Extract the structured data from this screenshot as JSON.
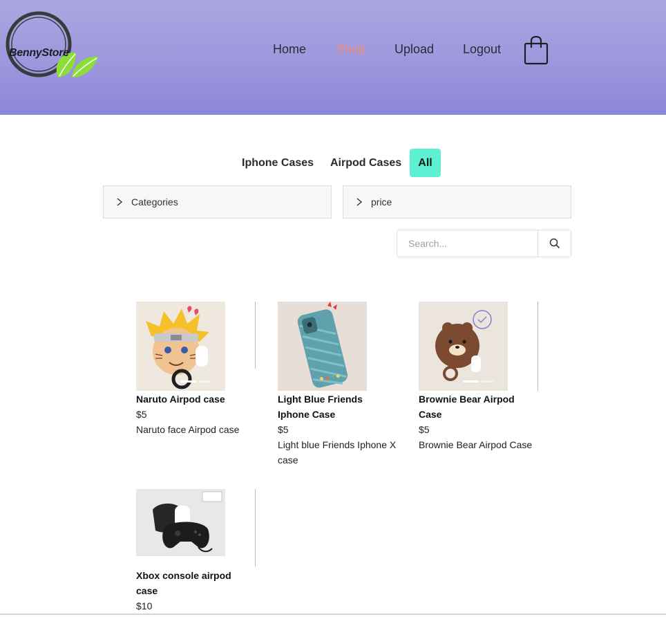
{
  "brand": {
    "name": "BennyStore",
    "leaf_color": "#8cdc3a",
    "ring_color": "#3a3a3a"
  },
  "nav": {
    "items": [
      {
        "label": "Home",
        "active": false
      },
      {
        "label": "Shop",
        "active": true
      },
      {
        "label": "Upload",
        "active": false
      },
      {
        "label": "Logout",
        "active": false
      }
    ],
    "active_color": "#f08a78",
    "cart_icon": "shopping-bag-icon"
  },
  "filters": {
    "tabs": [
      {
        "label": "Iphone Cases",
        "selected": false
      },
      {
        "label": "Airpod Cases",
        "selected": false
      },
      {
        "label": "All",
        "selected": true
      }
    ],
    "selected_color": "#5ef0d2",
    "accordions": [
      {
        "label": "Categories",
        "icon": "chevron-right-icon"
      },
      {
        "label": "price",
        "icon": "chevron-right-icon"
      }
    ]
  },
  "search": {
    "placeholder": "Search...",
    "value": "",
    "icon": "search-icon"
  },
  "products": [
    {
      "name": "Naruto Airpod case",
      "price": "$5",
      "description": "Naruto face Airpod case"
    },
    {
      "name": "Light Blue Friends Iphone Case",
      "price": "$5",
      "description": "Light blue Friends Iphone X case"
    },
    {
      "name": "Brownie Bear Airpod Case",
      "price": "$5",
      "description": "Brownie Bear Airpod Case"
    },
    {
      "name": "Xbox console airpod case",
      "price": "$10",
      "description": ""
    }
  ]
}
